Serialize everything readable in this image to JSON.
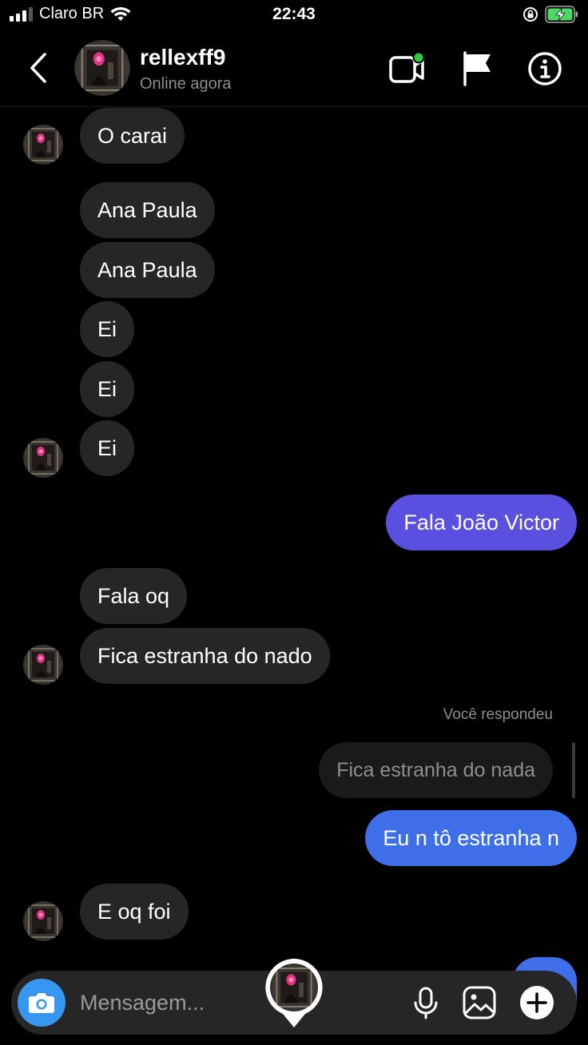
{
  "status_bar": {
    "carrier": "Claro BR",
    "time": "22:43"
  },
  "header": {
    "username": "rellexff9",
    "presence": "Online agora"
  },
  "messages": {
    "m1": "O carai",
    "m2": "Ana Paula",
    "m3": "Ana Paula",
    "m4": "Ei",
    "m5": "Ei",
    "m6": "Ei",
    "m7": "Fala João Victor",
    "m8": "Fala oq",
    "m9": "Fica estranha do nado",
    "reply_label": "Você respondeu",
    "reply_quote": "Fica estranha do nada",
    "m10": "Eu n tô estranha n",
    "m11": "E oq foi"
  },
  "composer": {
    "placeholder": "Mensagem..."
  },
  "colors": {
    "sent_purple": "#5b4fe0",
    "sent_blue": "#3f6fe8",
    "received": "#262626",
    "camera": "#3797f0",
    "active_dot": "#2ecc40",
    "battery": "#4cd964"
  },
  "icons": [
    "back-chevron-icon",
    "video-call-icon",
    "flag-icon",
    "info-icon",
    "camera-icon",
    "microphone-icon",
    "gallery-icon",
    "plus-icon",
    "wifi-icon",
    "lock-rotation-icon",
    "battery-icon"
  ]
}
